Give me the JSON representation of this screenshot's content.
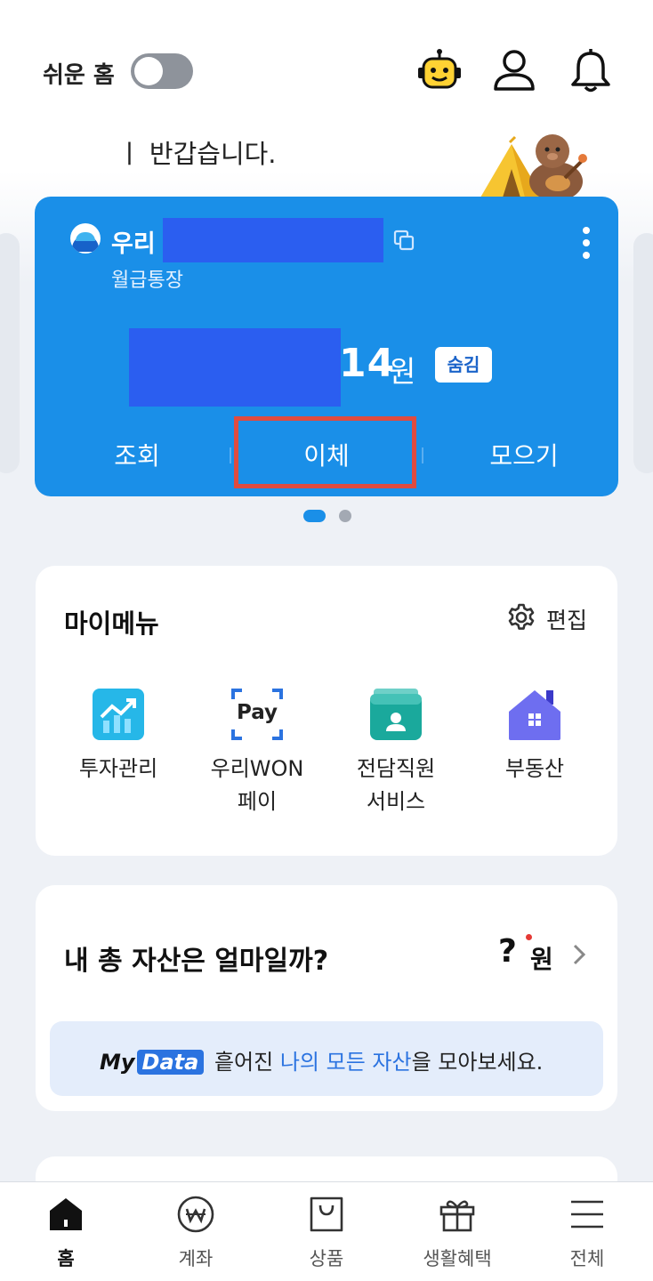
{
  "header": {
    "easy_home_label": "쉬운 홈",
    "greeting": "ㅣ 반갑습니다."
  },
  "account_card": {
    "bank_name": "우리",
    "account_type": "월급통장",
    "balance_visible": "14",
    "currency": "원",
    "hide_badge": "숨김",
    "actions": {
      "view": "조회",
      "transfer": "이체",
      "collect": "모으기"
    }
  },
  "pager": {
    "current_page": 1,
    "total_pages": 2
  },
  "my_menu": {
    "title": "마이메뉴",
    "edit_label": "편집",
    "items": [
      {
        "line1": "투자관리",
        "line2": ""
      },
      {
        "line1": "우리WON",
        "line2": "페이"
      },
      {
        "line1": "전담직원",
        "line2": "서비스"
      },
      {
        "line1": "부동산",
        "line2": ""
      }
    ],
    "pay_icon_text": "Pay"
  },
  "assets": {
    "title": "내 총 자산은 얼마일까?",
    "question_mark": "?",
    "currency": "원",
    "banner": {
      "my": "My",
      "data": "Data",
      "text1": " 흩어진 ",
      "highlight": "나의 모든 자산",
      "text2": "을 모아보세요."
    }
  },
  "bottom_nav": {
    "items": [
      {
        "label": "홈"
      },
      {
        "label": "계좌"
      },
      {
        "label": "상품"
      },
      {
        "label": "생활혜택"
      },
      {
        "label": "전체"
      }
    ],
    "active_index": 0
  },
  "colors": {
    "card_blue": "#1a8fe8",
    "redaction_blue": "#2b5ef0",
    "highlight_red": "#e04b3f",
    "link_blue": "#2b73e0"
  }
}
